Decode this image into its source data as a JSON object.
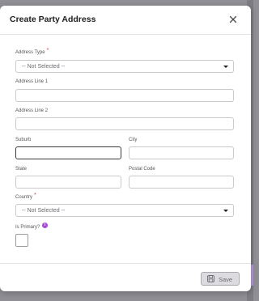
{
  "dialog": {
    "title": "Create Party Address",
    "close_icon": "close-icon"
  },
  "form": {
    "address_type": {
      "label": "Address Type",
      "required_marker": "*",
      "value": "-- Not Selected --"
    },
    "address_line_1": {
      "label": "Address Line 1",
      "value": ""
    },
    "address_line_2": {
      "label": "Address Line 2",
      "value": ""
    },
    "suburb": {
      "label": "Suburb",
      "value": ""
    },
    "city": {
      "label": "City",
      "value": ""
    },
    "state": {
      "label": "State",
      "value": ""
    },
    "postal_code": {
      "label": "Postal Code",
      "value": ""
    },
    "country": {
      "label": "Country",
      "required_marker": "*",
      "value": "-- Not Selected --"
    },
    "is_primary": {
      "label": "Is Primary?",
      "info_icon": "info-icon",
      "info_glyph": "i",
      "checked": false
    }
  },
  "footer": {
    "save_label": "Save",
    "save_icon": "floppy-disk-icon"
  },
  "colors": {
    "accent": "#a44fd0",
    "required": "#d33a3a",
    "backdrop": "#8f8f95"
  }
}
